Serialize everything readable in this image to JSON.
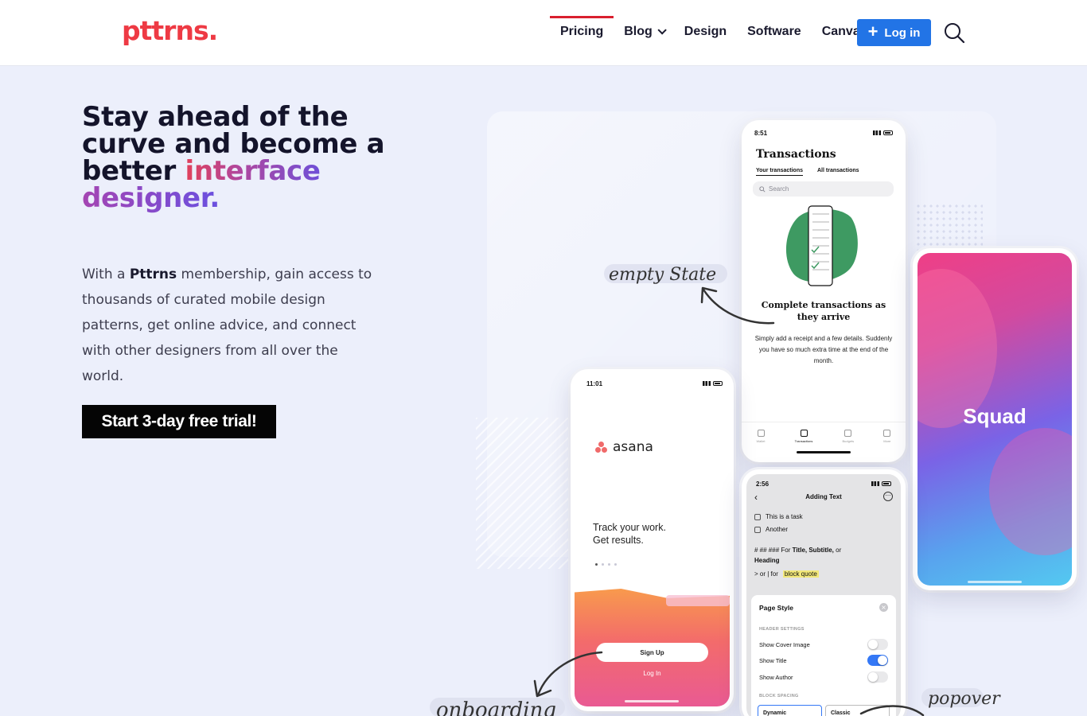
{
  "brand": {
    "logo": "pttrns.",
    "color": "#ee3a44"
  },
  "nav": {
    "items": [
      {
        "label": "Pricing",
        "active": true
      },
      {
        "label": "Blog",
        "has_dropdown": true
      },
      {
        "label": "Design"
      },
      {
        "label": "Software"
      },
      {
        "label": "Canva"
      }
    ],
    "login_label": "Log in",
    "accent": "#2274e6",
    "active_indicator": "#d91f2e"
  },
  "hero": {
    "title_plain": "Stay ahead of the curve and become a better ",
    "title_accent_1": "interface",
    "title_accent_2": "designer.",
    "body_prefix": "With a ",
    "body_brand": "Pttrns",
    "body_suffix": " membership, gain access to thousands of curated mobile design patterns, get online advice, and connect with other designers from all over the world.",
    "cta_label": "Start 3-day free trial!"
  },
  "annotations": {
    "empty_state": "empty State",
    "onboarding": "onboarding",
    "popover": "popover"
  },
  "phones": {
    "transactions": {
      "time": "8:51",
      "title": "Transactions",
      "tabs": [
        "Your transactions",
        "All transactions"
      ],
      "search_placeholder": "Search",
      "heading": "Complete transactions as they arrive",
      "body": "Simply add a receipt and a few details. Suddenly you have so much extra time at the end of the month.",
      "tabbar": [
        "Wallet",
        "Transactions",
        "Budgets",
        "More"
      ]
    },
    "squad": {
      "title": "Squad"
    },
    "asana": {
      "time": "11:01",
      "logo": "asana",
      "tagline_1": "Track your work.",
      "tagline_2": "Get results.",
      "signup": "Sign Up",
      "login": "Log In"
    },
    "adding_text": {
      "time": "2:56",
      "title": "Adding Text",
      "task_1": "This is a task",
      "task_2": "Another",
      "heading_hint_prefix": "# ## ### For ",
      "heading_hint_bold": "Title, Subtitle,",
      "heading_hint_mid": " or",
      "heading_hint_end": "Heading",
      "quote_hint_prefix": "> or | for",
      "quote_hint_hl": "block quote",
      "sheet_title": "Page Style",
      "section_header": "HEADER SETTINGS",
      "toggles": [
        {
          "label": "Show Cover Image",
          "on": false
        },
        {
          "label": "Show Title",
          "on": true
        },
        {
          "label": "Show Author",
          "on": false
        }
      ],
      "section_spacing": "BLOCK SPACING",
      "spacing_options": [
        "Dynamic",
        "Classic"
      ]
    }
  }
}
